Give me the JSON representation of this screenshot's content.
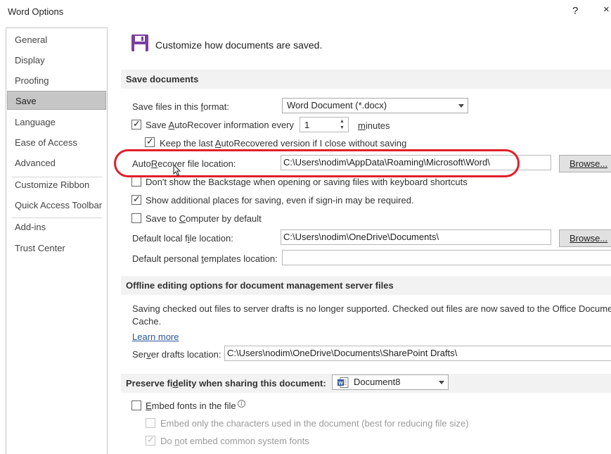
{
  "window": {
    "title": "Word Options",
    "help": "?",
    "close": "×"
  },
  "nav": {
    "items": [
      "General",
      "Display",
      "Proofing",
      "Save",
      "Language",
      "Ease of Access",
      "Advanced",
      "Customize Ribbon",
      "Quick Access Toolbar",
      "Add-ins",
      "Trust Center"
    ],
    "selected": "Save"
  },
  "header": {
    "text": "Customize how documents are saved."
  },
  "save_documents": {
    "section_title": "Save documents",
    "format_label_pre": "Save files in this ",
    "format_label_u": "f",
    "format_label_post": "ormat:",
    "format_value": "Word Document (*.docx)",
    "autorecover_pre": "Save ",
    "autorecover_u": "A",
    "autorecover_post": "utoRecover information every",
    "autorecover_checked": true,
    "autorecover_minutes": "1",
    "minutes_pre": "",
    "minutes_u": "m",
    "minutes_post": "inutes",
    "keep_last_pre": "Keep the last ",
    "keep_last_u": "A",
    "keep_last_post": "utoRecovered version if I close without saving",
    "keep_last_checked": true,
    "autorecover_location_pre": "Auto",
    "autorecover_location_u": "R",
    "autorecover_location_post": "ecover file location:",
    "autorecover_location_value": "C:\\Users\\nodim\\AppData\\Roaming\\Microsoft\\Word\\",
    "browse1": "Browse...",
    "dont_show_backstage": "Don't show the Backstage when opening or saving files with keyboard shortcuts",
    "dont_show_backstage_checked": false,
    "show_additional": "Show additional places for saving, even if sign-in may be required.",
    "show_additional_checked": true,
    "save_to_computer_pre": "Save to ",
    "save_to_computer_u": "C",
    "save_to_computer_post": "omputer by default",
    "save_to_computer_checked": false,
    "default_local_pre": "Default local f",
    "default_local_u": "i",
    "default_local_post": "le location:",
    "default_local_value": "C:\\Users\\nodim\\OneDrive\\Documents\\",
    "browse2": "Browse...",
    "default_templates_pre": "Default personal ",
    "default_templates_u": "t",
    "default_templates_post": "emplates location:",
    "default_templates_value": ""
  },
  "offline": {
    "section_title": "Offline editing options for document management server files",
    "notice_line1": "Saving checked out files to server drafts is no longer supported. Checked out files are now saved to the Office Document",
    "notice_line2": "Cache.",
    "learn_more": "Learn more",
    "server_drafts_pre": "Ser",
    "server_drafts_u": "v",
    "server_drafts_post": "er drafts location:",
    "server_drafts_value": "C:\\Users\\nodim\\OneDrive\\Documents\\SharePoint Drafts\\"
  },
  "fidelity": {
    "section_title_pre": "Preserve fi",
    "section_title_u": "d",
    "section_title_post": "elity when sharing this document:",
    "document_value": "Document8",
    "embed_fonts_pre": "",
    "embed_fonts_u": "E",
    "embed_fonts_post": "mbed fonts in the file",
    "embed_fonts_checked": false,
    "embed_only": "Embed only the characters used in the document (best for reducing file size)",
    "embed_only_checked": false,
    "do_not_embed_pre": "Do ",
    "do_not_embed_u": "n",
    "do_not_embed_post": "ot embed common system fonts",
    "do_not_embed_checked": true
  },
  "colors": {
    "accent_purple": "#7b3fa0",
    "highlight_red": "#e0202a",
    "word_blue": "#2b579a"
  },
  "icons": {
    "save": "floppy-disk-icon",
    "info": "info-icon",
    "word_doc": "word-document-icon",
    "cursor": "mouse-pointer-icon"
  }
}
